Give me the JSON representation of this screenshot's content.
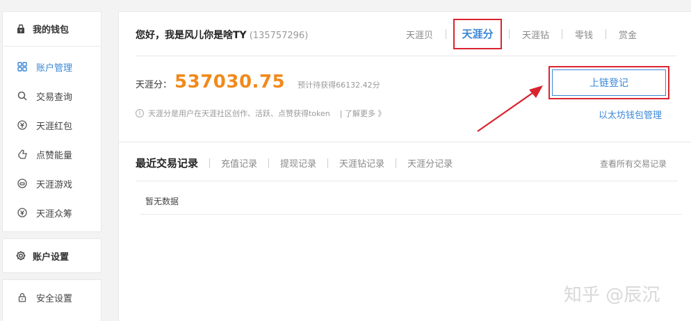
{
  "sidebar": {
    "wallet": {
      "label": "我的钱包",
      "icon": "wallet-icon"
    },
    "items": [
      {
        "label": "账户管理",
        "icon": "grid-icon",
        "active": true
      },
      {
        "label": "交易查询",
        "icon": "search-icon"
      },
      {
        "label": "天涯红包",
        "icon": "red-packet-icon"
      },
      {
        "label": "点赞能量",
        "icon": "thumb-up-icon"
      },
      {
        "label": "天涯游戏",
        "icon": "game-icon"
      },
      {
        "label": "天涯众筹",
        "icon": "crowdfunding-icon"
      }
    ],
    "settings": {
      "label": "账户设置",
      "icon": "gear-icon"
    },
    "security": {
      "label": "安全设置",
      "icon": "lock-icon"
    }
  },
  "header": {
    "greeting": "您好，我是风儿你是啥TY",
    "uid": "(135757296)",
    "tabs": [
      "天涯贝",
      "天涯分",
      "天涯钻",
      "零钱",
      "赏金"
    ],
    "active_tab": "天涯分"
  },
  "score": {
    "label": "天涯分：",
    "value": "537030.75",
    "note": "预计待获得66132.42分",
    "info": "天涯分是用户在天涯社区创作、活跃、点赞获得token",
    "more": "| 了解更多 》"
  },
  "actions": {
    "chain_register": "上链登记",
    "eth_wallet": "以太坊钱包管理"
  },
  "records": {
    "title": "最近交易记录",
    "tabs": [
      "充值记录",
      "提现记录",
      "天涯钻记录",
      "天涯分记录"
    ],
    "view_all": "查看所有交易记录",
    "empty": "暂无数据"
  },
  "watermark": "知乎 @辰沉",
  "colors": {
    "accent": "#3a87d6",
    "highlight_box": "#d9232f",
    "score": "#f08a1c"
  }
}
